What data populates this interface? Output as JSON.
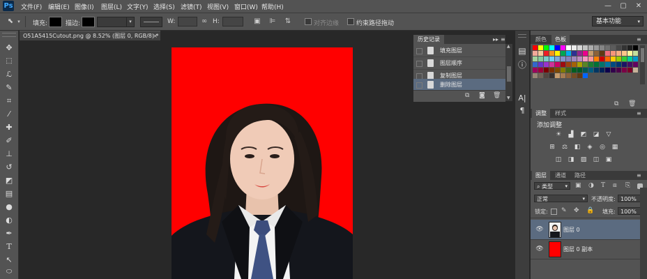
{
  "app": {
    "logo": "Ps"
  },
  "menu": [
    "文件(F)",
    "编辑(E)",
    "图像(I)",
    "图层(L)",
    "文字(Y)",
    "选择(S)",
    "滤镜(T)",
    "视图(V)",
    "窗口(W)",
    "帮助(H)"
  ],
  "window_controls": [
    "—",
    "▢",
    "✕"
  ],
  "options_bar": {
    "fill_label": "填充:",
    "stroke_label": "描边:",
    "w_label": "W:",
    "h_label": "H:",
    "align_edges_label": "对齐边缘",
    "constrain_path_label": "约束路径拖动",
    "workspace": "基本功能"
  },
  "document": {
    "tab_title": "O51A5415Cutout.png @ 8.52% (图层 0, RGB/8) *",
    "tab_close": "×"
  },
  "history": {
    "tab": "历史记录",
    "items": [
      {
        "label": "填充图层"
      },
      {
        "label": "图层顺序"
      },
      {
        "label": "复制图层"
      },
      {
        "label": "删除图层"
      }
    ]
  },
  "swatches_panel": {
    "tabs": [
      "颜色",
      "色板"
    ],
    "colors": [
      "#ff0000",
      "#ffff00",
      "#00ff00",
      "#00ffff",
      "#0000ff",
      "#ff00ff",
      "#ffffff",
      "#ebebeb",
      "#d6d6d6",
      "#c2c2c2",
      "#adadad",
      "#999999",
      "#858585",
      "#707070",
      "#5c5c5c",
      "#474747",
      "#333333",
      "#1f1f1f",
      "#000000",
      "#f2a999",
      "#f7c89c",
      "#ed1c24",
      "#f7941d",
      "#fff200",
      "#00a651",
      "#00aeef",
      "#2e3192",
      "#92278f",
      "#ec008c",
      "#c69c6d",
      "#8c6239",
      "#603913",
      "#f26d7d",
      "#f69679",
      "#f9ad81",
      "#fdc689",
      "#fff799",
      "#c4df9b",
      "#a3d39c",
      "#82ca9c",
      "#7accc8",
      "#6dcff6",
      "#7da7d9",
      "#8393ca",
      "#8781bd",
      "#a186be",
      "#bd8cbf",
      "#f49ac1",
      "#f5989d",
      "#ff7f00",
      "#cc0000",
      "#ff6600",
      "#ffcc00",
      "#99cc00",
      "#33cc33",
      "#00cc99",
      "#0099cc",
      "#3366cc",
      "#6633cc",
      "#9933cc",
      "#cc3399",
      "#cc0066",
      "#9e0b0f",
      "#a0410d",
      "#a36209",
      "#aba000",
      "#598527",
      "#1a7b30",
      "#007236",
      "#00746b",
      "#0076a3",
      "#004b80",
      "#003471",
      "#1b1464",
      "#440e62",
      "#630460",
      "#9e005d",
      "#9e0039",
      "#790000",
      "#7b2e00",
      "#7d4900",
      "#827b00",
      "#406618",
      "#005e20",
      "#005826",
      "#005952",
      "#005b7f",
      "#003663",
      "#002157",
      "#0d004c",
      "#32004b",
      "#4b0049",
      "#7b0046",
      "#7a0026",
      "#c7b299",
      "#998675",
      "#736357",
      "#534741",
      "#37302d",
      "#c69c6d",
      "#a67c52",
      "#8c6239",
      "#754c24",
      "#603913",
      "#0066ff"
    ]
  },
  "adjustments_panel": {
    "tabs": [
      "调整",
      "样式"
    ],
    "title": "添加调整",
    "icon_rows": [
      5,
      6,
      5
    ]
  },
  "layers_panel": {
    "tabs": [
      "图层",
      "通道",
      "路径"
    ],
    "filter_kind": "类型",
    "blend_mode": "正常",
    "opacity_label": "不透明度:",
    "opacity_value": "100%",
    "lock_label": "锁定:",
    "fill_label": "填充:",
    "fill_value": "100%",
    "layers": [
      {
        "name": "图层 0",
        "selected": true
      },
      {
        "name": "图层 0 副本",
        "selected": false
      }
    ]
  },
  "colors": {
    "canvas_bg": "#ff0000",
    "panel": "#535353",
    "selected_row": "#5b6b80"
  }
}
